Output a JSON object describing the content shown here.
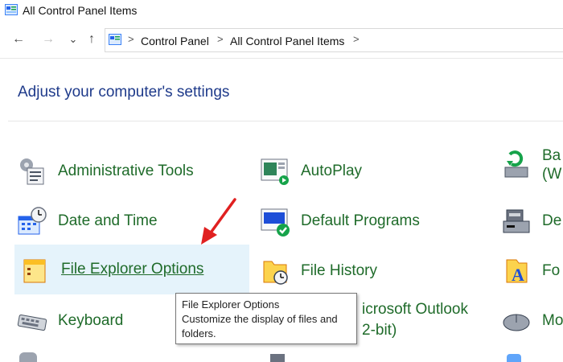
{
  "window": {
    "title": "All Control Panel Items"
  },
  "navigation": {
    "back_glyph": "←",
    "forward_glyph": "→",
    "recent_glyph": "⌄",
    "up_glyph": "↑",
    "breadcrumb": [
      "Control Panel",
      "All Control Panel Items"
    ],
    "separator": ">"
  },
  "main": {
    "heading": "Adjust your computer's settings",
    "items": [
      {
        "label": "Administrative Tools",
        "icon": "admin-tools-icon"
      },
      {
        "label": "AutoPlay",
        "icon": "autoplay-icon"
      },
      {
        "label": "Ba",
        "sub": "(W",
        "icon": "backup-icon"
      },
      {
        "label": "Date and Time",
        "icon": "date-time-icon"
      },
      {
        "label": "Default Programs",
        "icon": "default-programs-icon"
      },
      {
        "label": "De",
        "icon": "device-manager-icon"
      },
      {
        "label": "File Explorer Options",
        "icon": "folder-options-icon"
      },
      {
        "label": "File History",
        "icon": "file-history-icon"
      },
      {
        "label": "Fo",
        "icon": "fonts-icon"
      },
      {
        "label": "Keyboard",
        "icon": "keyboard-icon"
      },
      {
        "label": "icrosoft Outlook",
        "sub": "2-bit)",
        "icon": "outlook-icon"
      },
      {
        "label": "Mo",
        "icon": "mouse-icon"
      }
    ]
  },
  "tooltip": {
    "title": "File Explorer Options",
    "description": "Customize the display of files and folders."
  },
  "colors": {
    "link_green": "#1f6b2a",
    "heading_blue": "#1e3a8a",
    "hover_bg": "#e5f3fb",
    "arrow_red": "#e02020"
  }
}
